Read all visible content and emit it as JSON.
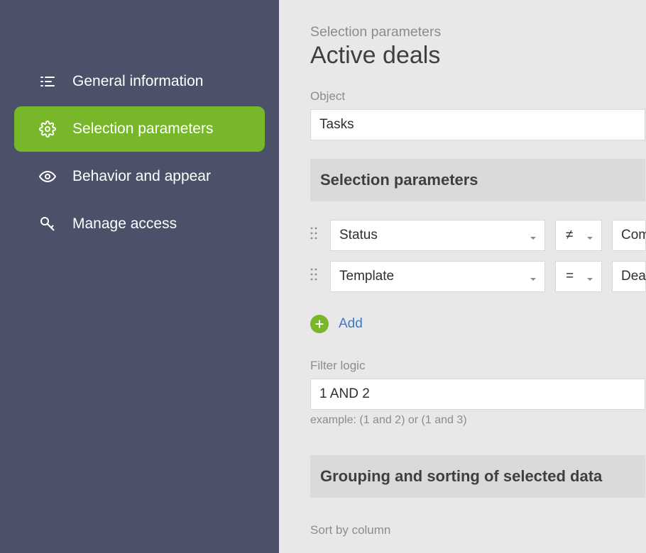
{
  "sidebar": {
    "items": [
      {
        "label": "General information"
      },
      {
        "label": "Selection parameters"
      },
      {
        "label": "Behavior and appear"
      },
      {
        "label": "Manage access"
      }
    ]
  },
  "header": {
    "breadcrumb": "Selection parameters",
    "title": "Active deals"
  },
  "object": {
    "label": "Object",
    "value": "Tasks"
  },
  "section_selection_params": "Selection parameters",
  "filters": [
    {
      "field": "Status",
      "operator": "≠",
      "value": "Comp"
    },
    {
      "field": "Template",
      "operator": "=",
      "value": "Deal"
    }
  ],
  "add_label": "Add",
  "filter_logic": {
    "label": "Filter logic",
    "value": "1 AND 2",
    "example": "example: (1 and 2) or (1 and 3)"
  },
  "section_grouping": "Grouping and sorting of selected data",
  "sort_label": "Sort by column"
}
